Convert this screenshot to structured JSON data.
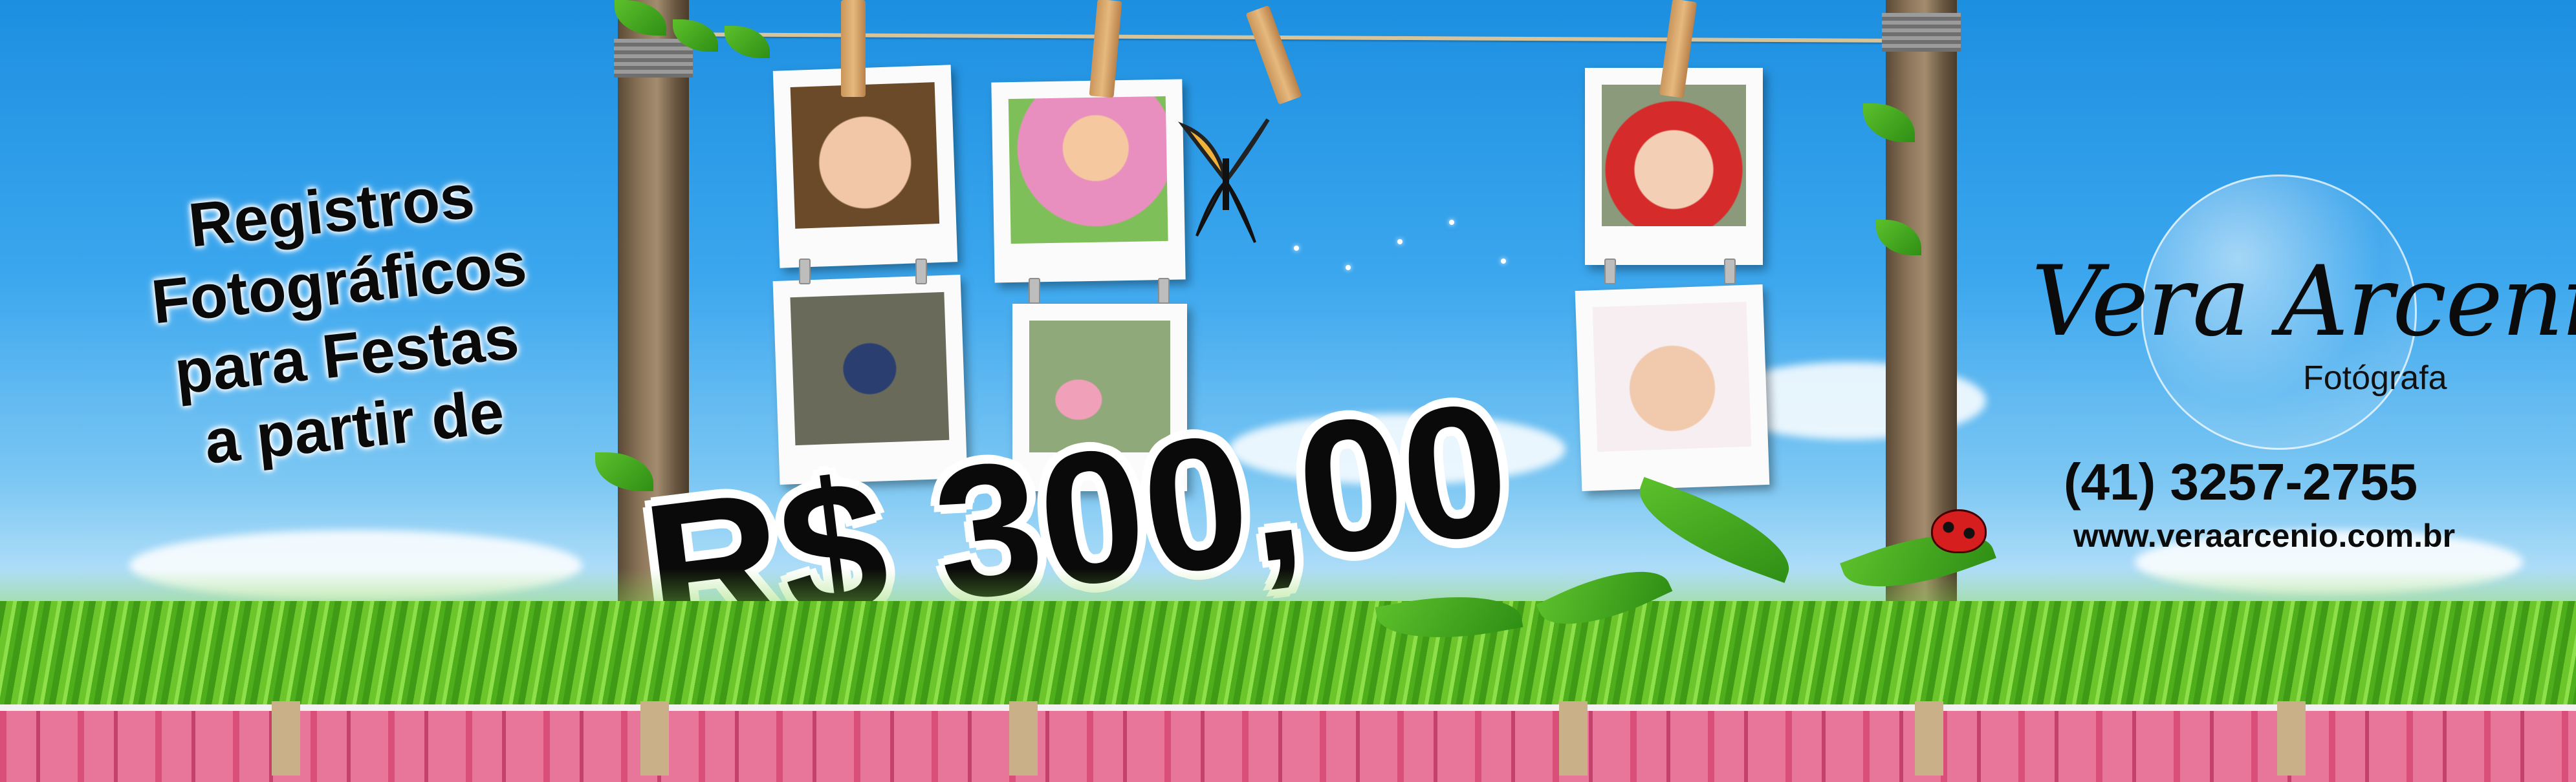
{
  "banner": {
    "headline": [
      "Registros",
      "Fotográficos",
      "para Festas",
      "a partir de"
    ],
    "price": "R$ 300,00",
    "brand_name": "Vera Arcenio",
    "brand_role": "Fotógrafa",
    "phone": "(41) 3257-2755",
    "website": "www.veraarcenio.com.br"
  },
  "photos": [
    {
      "name": "photo-baby-bear-costume",
      "colors": [
        "#6b4a2a",
        "#f1c7a8"
      ]
    },
    {
      "name": "photo-doll-princess",
      "colors": [
        "#e88fbf",
        "#7fbf5a"
      ]
    },
    {
      "name": "photo-toddler-walking",
      "colors": [
        "#6a6a5a",
        "#2a3f6f"
      ]
    },
    {
      "name": "photo-child-with-case",
      "colors": [
        "#8fa97a",
        "#f0a0b8"
      ]
    },
    {
      "name": "photo-baby-red-hat",
      "colors": [
        "#d62b2b",
        "#f3d0b5"
      ]
    },
    {
      "name": "photo-baby-white-hat",
      "colors": [
        "#f6eef0",
        "#f1c9ad"
      ]
    }
  ],
  "colors": {
    "sky_top": "#1d8fe0",
    "sky_bottom": "#e8f6fd",
    "fence": "#e8759a",
    "grass": "#6cc52a",
    "text": "#0a0a0a"
  }
}
